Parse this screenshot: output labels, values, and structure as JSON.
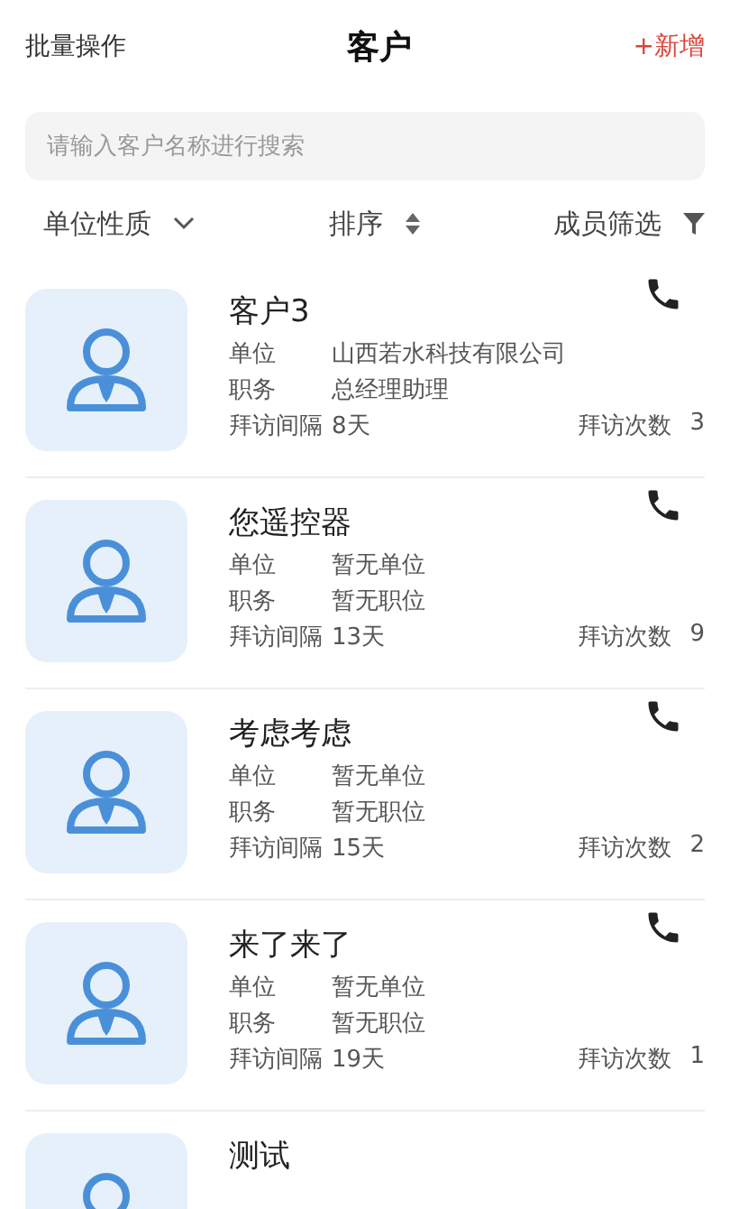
{
  "header": {
    "left_action": "批量操作",
    "title": "客户",
    "right_action": "+新增"
  },
  "search": {
    "placeholder": "请输入客户名称进行搜索"
  },
  "filters": [
    {
      "label": "单位性质",
      "kind": "dropdown"
    },
    {
      "label": "排序",
      "kind": "sort"
    },
    {
      "label": "成员筛选",
      "kind": "filter"
    }
  ],
  "customers": [
    {
      "name": "客户3",
      "company_label": "单位",
      "company": "山西若水科技有限公司",
      "position_label": "职务",
      "position": "总经理助理",
      "interval_label": "拜访间隔",
      "interval": "8天",
      "visits_label": "拜访次数",
      "visits": "3"
    },
    {
      "name": "您遥控器",
      "company_label": "单位",
      "company": "暂无单位",
      "position_label": "职务",
      "position": "暂无职位",
      "interval_label": "拜访间隔",
      "interval": "13天",
      "visits_label": "拜访次数",
      "visits": "9"
    },
    {
      "name": "考虑考虑",
      "company_label": "单位",
      "company": "暂无单位",
      "position_label": "职务",
      "position": "暂无职位",
      "interval_label": "拜访间隔",
      "interval": "15天",
      "visits_label": "拜访次数",
      "visits": "2"
    },
    {
      "name": "来了来了",
      "company_label": "单位",
      "company": "暂无单位",
      "position_label": "职务",
      "position": "暂无职位",
      "interval_label": "拜访间隔",
      "interval": "19天",
      "visits_label": "拜访次数",
      "visits": "1"
    },
    {
      "name": "测试"
    }
  ]
}
